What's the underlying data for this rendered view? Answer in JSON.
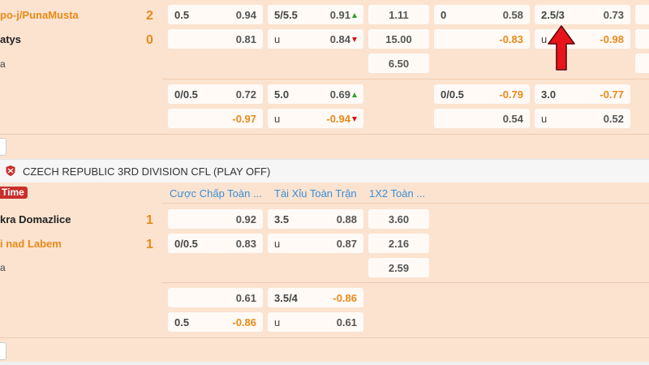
{
  "match1": {
    "team_home": "po-j/PunaMusta",
    "team_away": "atys",
    "draw_label": "a",
    "score_home": "2",
    "score_away": "0",
    "row1": {
      "hdp_line": "0.5",
      "hdp_odds": "0.94",
      "ou_line": "5/5.5",
      "ou_odds": "0.91",
      "x12": "1.11",
      "h1_hdp_line": "0",
      "h1_hdp_odds": "0.58",
      "h1_ou_line": "2.5/3",
      "h1_ou_odds": "0.73"
    },
    "row2": {
      "hdp_odds": "0.81",
      "ou_label": "u",
      "ou_odds": "0.84",
      "x12": "15.00",
      "h1_hdp_odds": "-0.83",
      "h1_ou_label": "u",
      "h1_ou_odds": "-0.98"
    },
    "row3": {
      "x12": "6.50"
    },
    "alt1": {
      "hdp_line": "0/0.5",
      "hdp_odds": "0.72",
      "ou_line": "5.0",
      "ou_odds": "0.69",
      "h1_hdp_line": "0/0.5",
      "h1_hdp_odds": "-0.79",
      "h1_ou_line": "3.0",
      "h1_ou_odds": "-0.77"
    },
    "alt2": {
      "hdp_odds": "-0.97",
      "ou_label": "u",
      "ou_odds": "-0.94",
      "h1_hdp_odds": "0.54",
      "h1_ou_label": "u",
      "h1_ou_odds": "0.52"
    }
  },
  "league": {
    "title": "CZECH REPUBLIC 3RD DIVISION CFL (PLAY OFF)",
    "time_badge": "Time",
    "col_hdp": "Cược Chấp Toàn ...",
    "col_ou": "Tài Xỉu Toàn Trận",
    "col_1x2": "1X2 Toàn ..."
  },
  "match2": {
    "team_home": "kra Domazlice",
    "team_away": "i nad Labem",
    "draw_label": "a",
    "score_home": "1",
    "score_away": "1",
    "row1": {
      "hdp_odds": "0.92",
      "ou_line": "3.5",
      "ou_odds": "0.88",
      "x12": "3.60"
    },
    "row2": {
      "hdp_line": "0/0.5",
      "hdp_odds": "0.83",
      "ou_label": "u",
      "ou_odds": "0.87",
      "x12": "2.16"
    },
    "row3": {
      "x12": "2.59"
    },
    "alt1": {
      "hdp_odds": "0.61",
      "ou_line": "3.5/4",
      "ou_odds": "-0.86"
    },
    "alt2": {
      "hdp_line": "0.5",
      "hdp_odds": "-0.86",
      "ou_label": "u",
      "ou_odds": "0.61"
    }
  },
  "colors": {
    "accent_orange": "#e88a1a",
    "link_blue": "#3a8fd6",
    "badge_red": "#c8302c",
    "arrow_red": "#e8141c"
  }
}
